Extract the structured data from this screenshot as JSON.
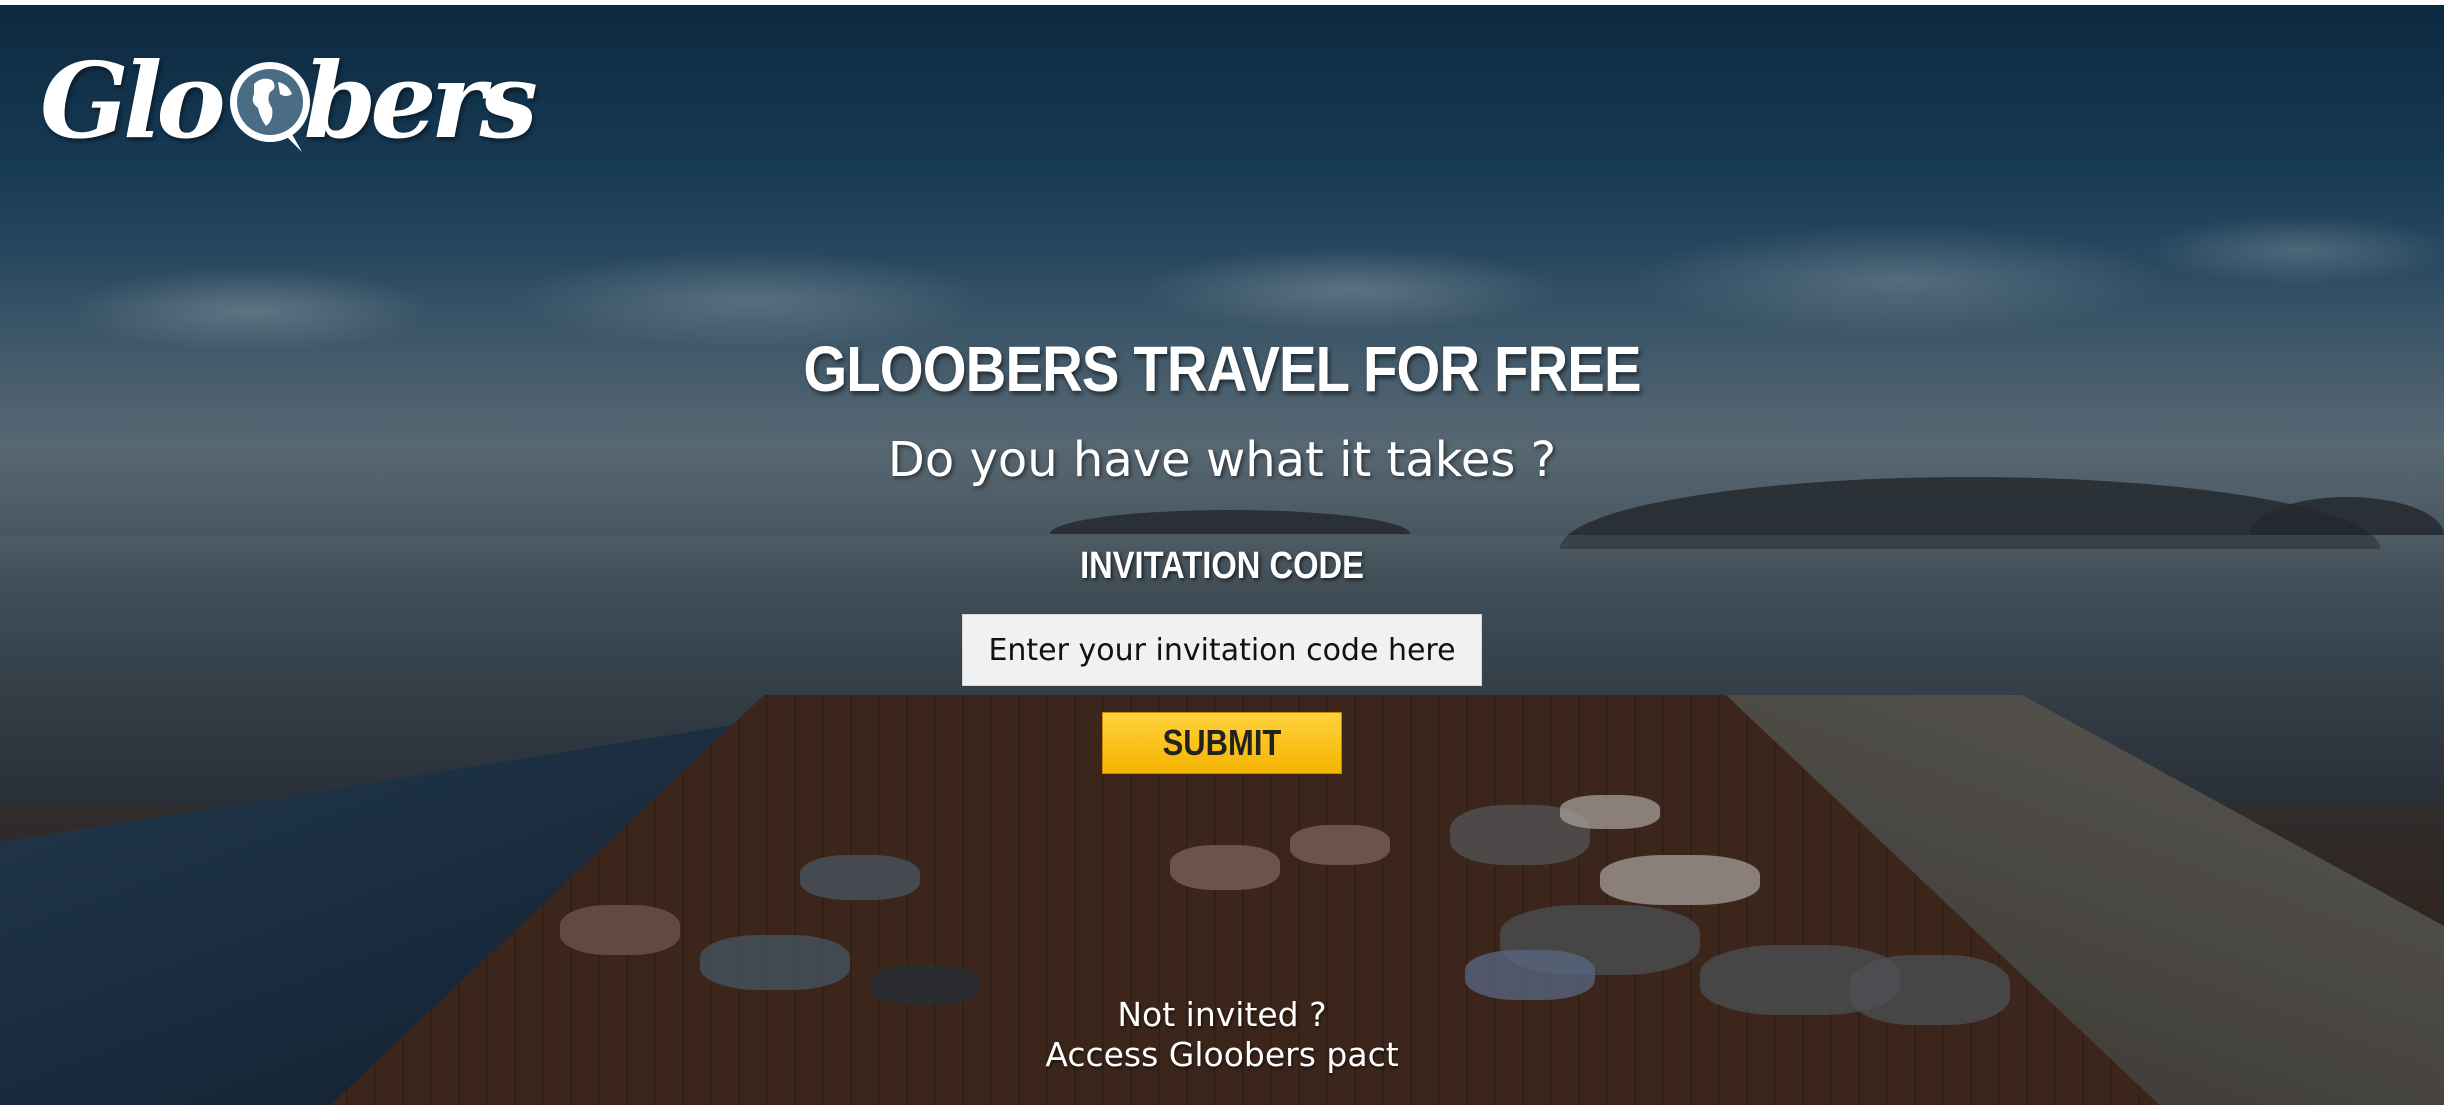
{
  "brand": {
    "logo_text": "Gloobers"
  },
  "hero": {
    "headline": "GLOOBERS TRAVEL FOR FREE",
    "subheadline": "Do you have what it takes ?"
  },
  "invitation_form": {
    "label": "INVITATION CODE",
    "input_value": "",
    "input_placeholder": "Enter your invitation code here",
    "submit_label": "SUBMIT"
  },
  "footer": {
    "not_invited_text": "Not invited ?",
    "access_link_text": "Access Gloobers pact"
  },
  "icons": {
    "logo_globe": "globe-speech-bubble-icon"
  },
  "colors": {
    "submit_button": "#f5b400",
    "text": "#ffffff",
    "input_background": "#f1f1f1"
  }
}
